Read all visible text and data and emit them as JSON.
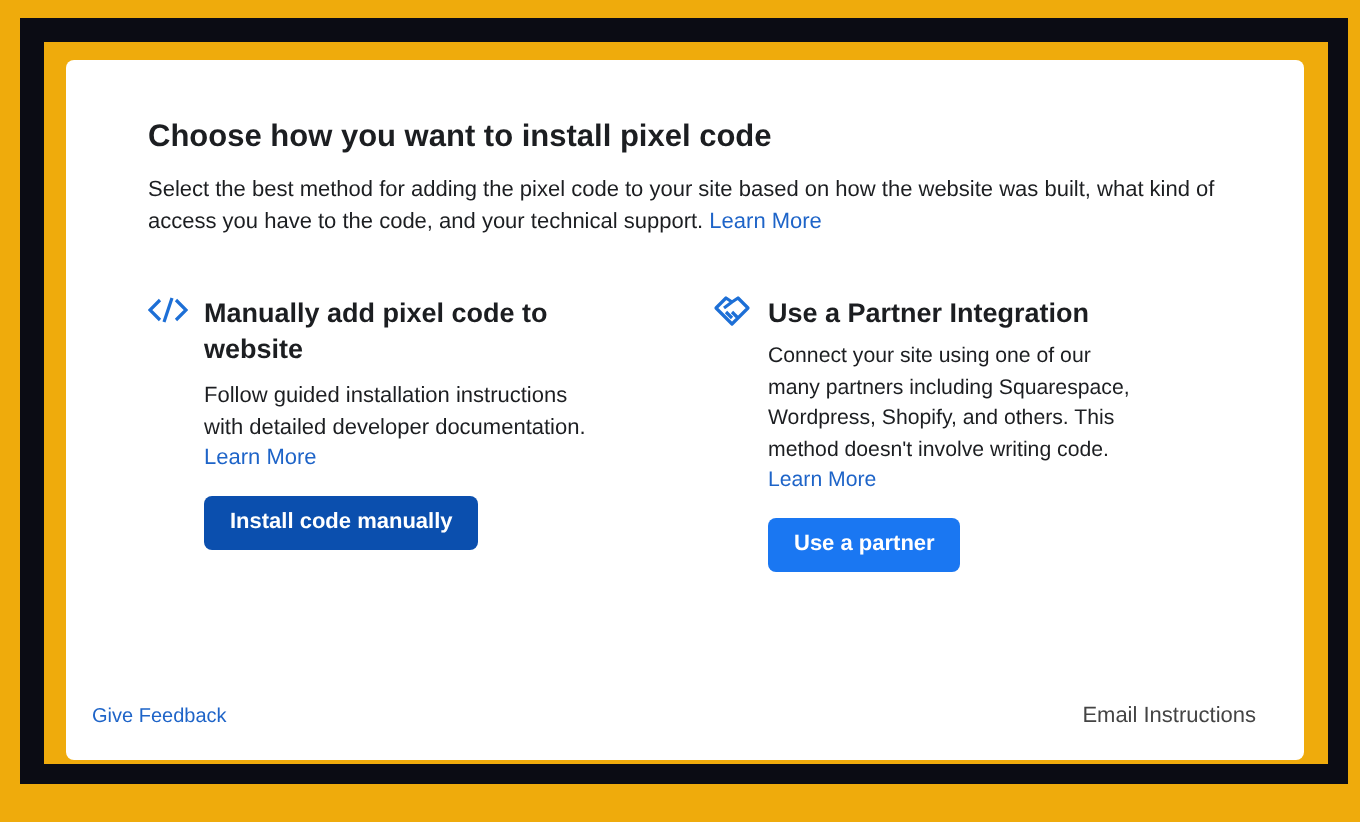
{
  "dialog": {
    "title": "Choose how you want to install pixel code",
    "description": "Select the best method for adding the pixel code to your site based on how the website was built, what kind of access you have to the code, and your technical support.",
    "description_link": "Learn More",
    "options": [
      {
        "kind": "code",
        "title": "Manually add pixel code to website",
        "text": "Follow guided installation instructions with detailed developer documentation.",
        "link": "Learn More",
        "button": "Install code manually"
      },
      {
        "kind": "partner",
        "title": "Use a Partner Integration",
        "text": "Connect your site using one of our many partners including Squarespace, Wordpress, Shopify, and others. This method doesn't involve writing code.",
        "link": "Learn More",
        "button": "Use a partner"
      }
    ],
    "footer": {
      "feedback_link": "Give Feedback",
      "email_button": "Email Instructions"
    }
  }
}
